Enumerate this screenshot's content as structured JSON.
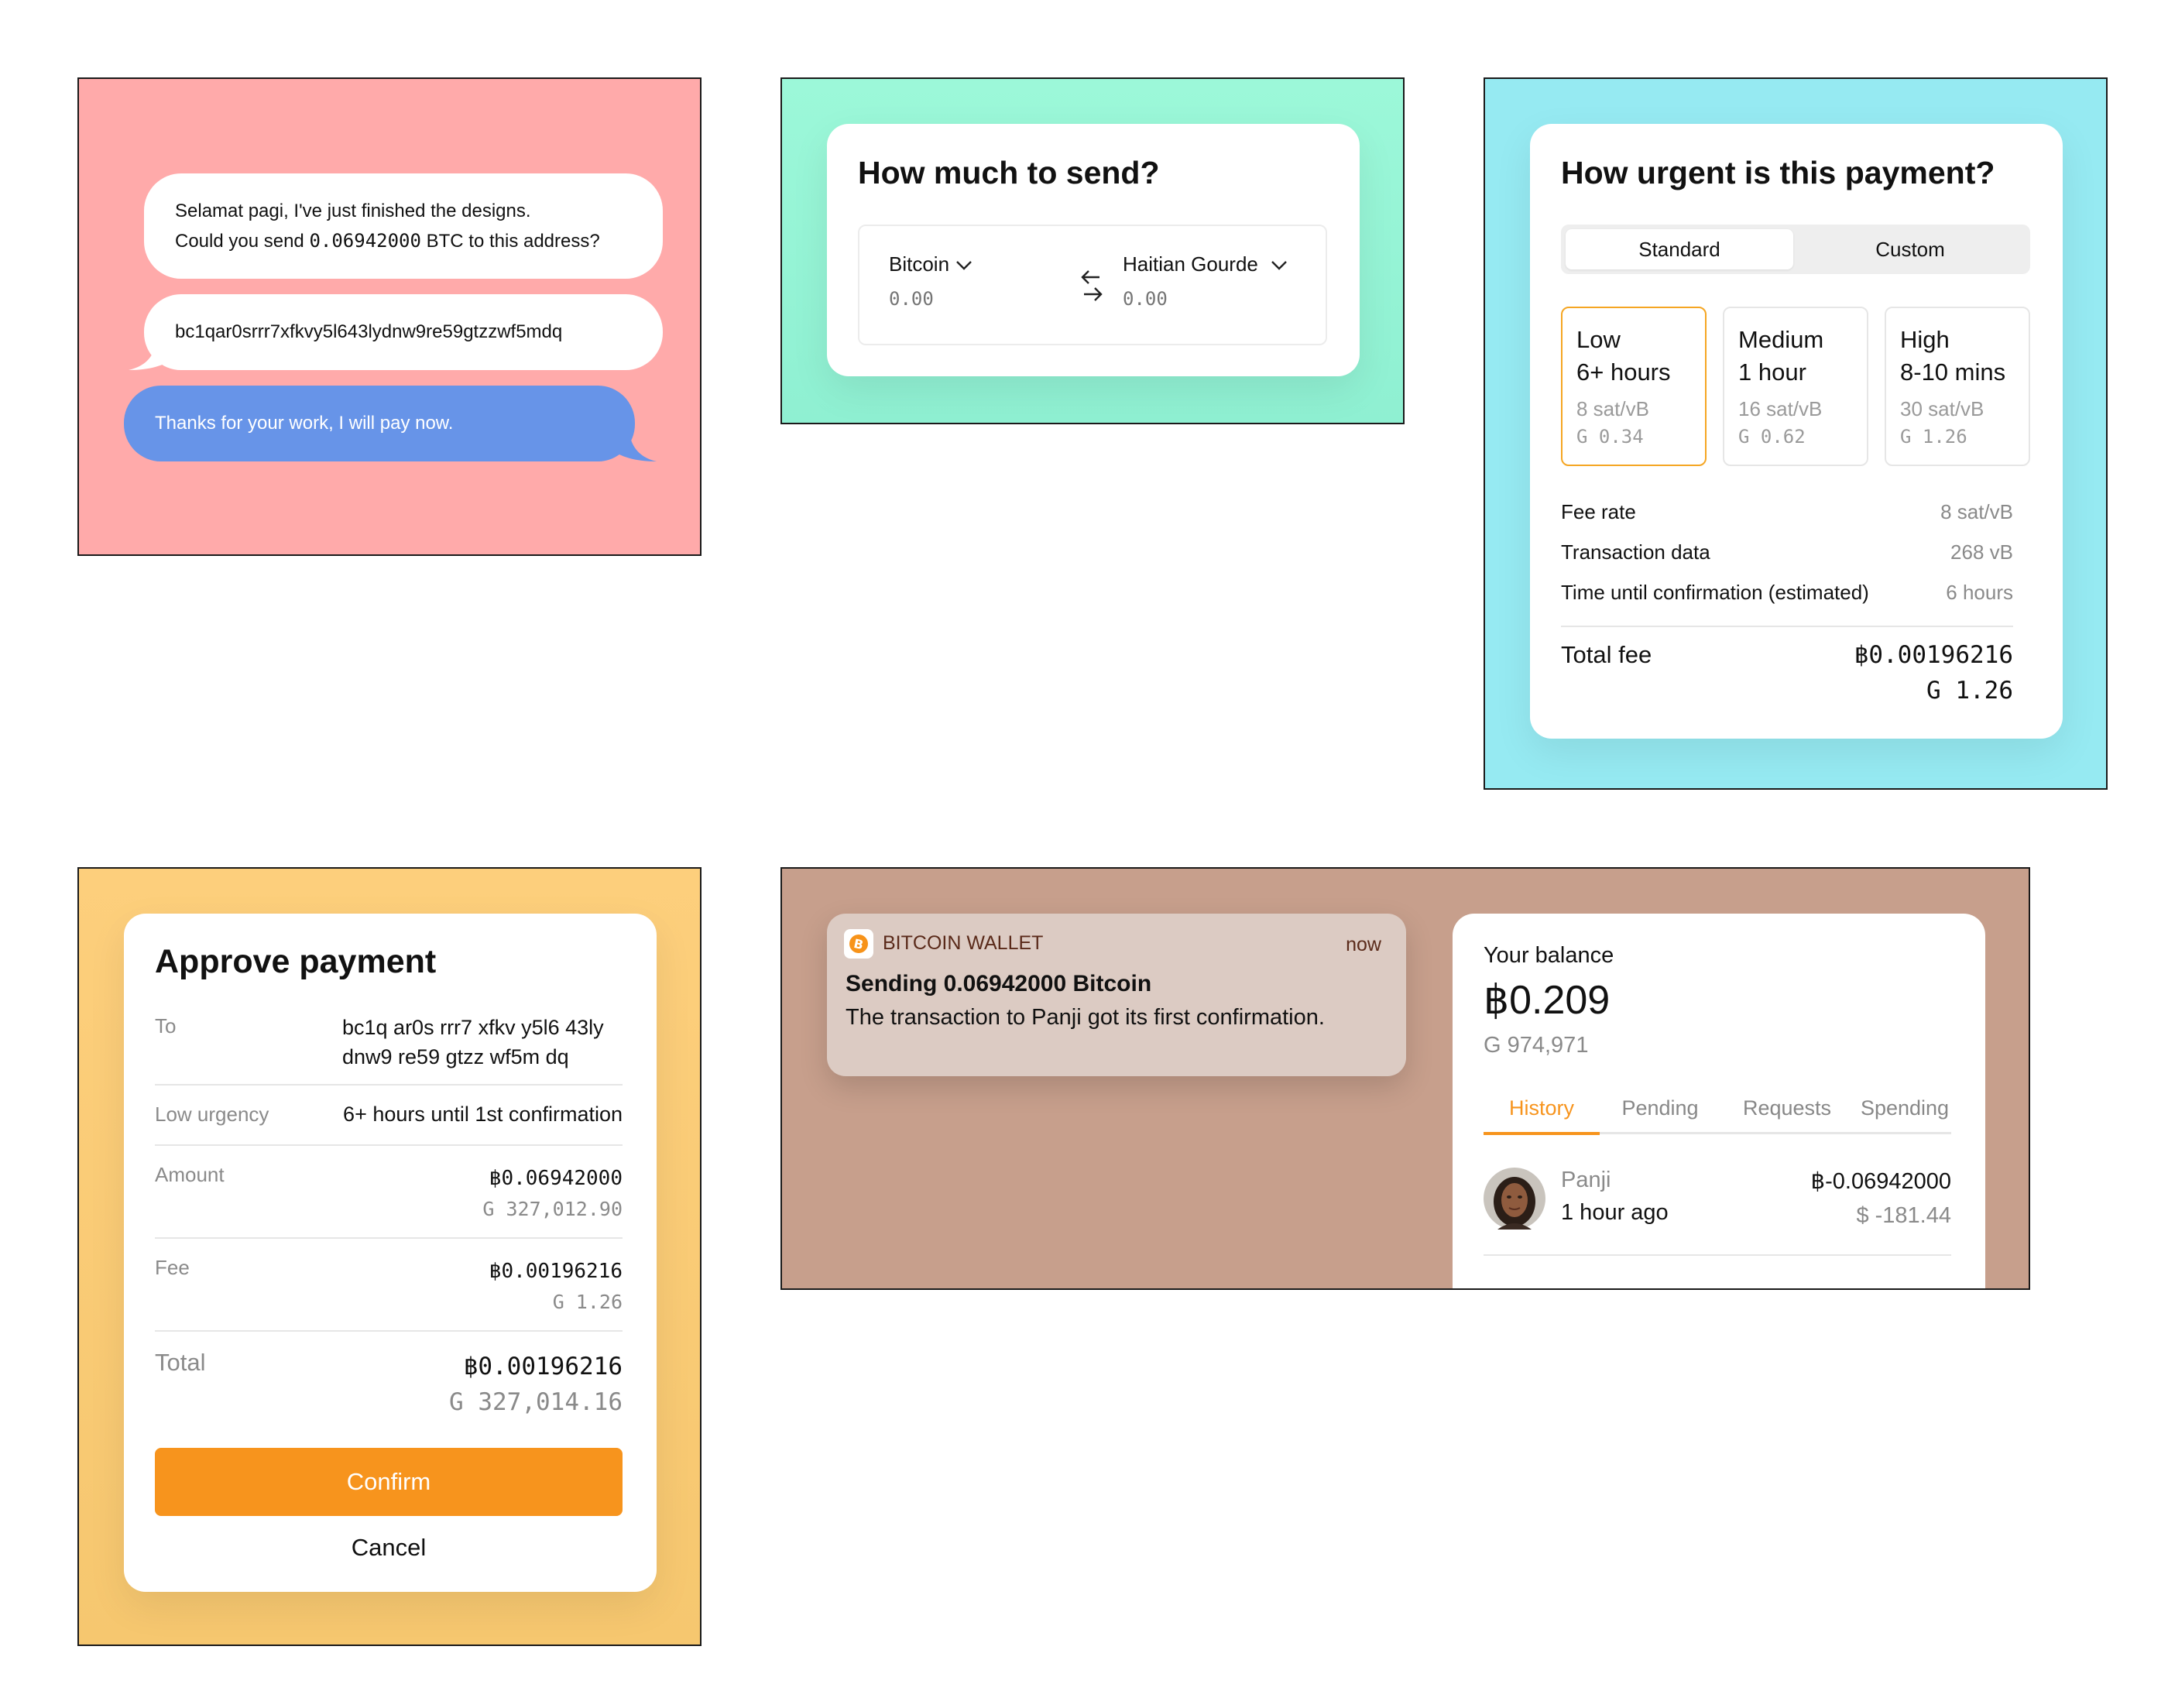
{
  "chat": {
    "message1_line1": "Selamat pagi, I've just finished the designs.",
    "message1_line2_pre": "Could you send ",
    "message1_amount": "0.06942000",
    "message1_line2_post": " BTC to this address?",
    "message2": "bc1qar0srrr7xfkvy5l643lydnw9re59gtzzwf5mdq",
    "message3": "Thanks for your work, I will pay now.",
    "colors": {
      "background": "#ffaaaa",
      "incoming": "#ffffff",
      "outgoing": "#6794e8"
    }
  },
  "send": {
    "title": "How much to send?",
    "from_currency": "Bitcoin",
    "from_placeholder": "0.00",
    "to_currency": "Haitian Gourde",
    "to_placeholder": "0.00",
    "icons": {
      "dropdown": "chevron-down-icon",
      "swap": "swap-arrows-icon"
    }
  },
  "urgency": {
    "title": "How urgent is this payment?",
    "tabs": [
      "Standard",
      "Custom"
    ],
    "selected_tab": "Standard",
    "tiers": [
      {
        "label": "Low",
        "time": "6+ hours",
        "rate": "8 sat/vB",
        "fee": "G 0.34",
        "selected": true
      },
      {
        "label": "Medium",
        "time": "1 hour",
        "rate": "16 sat/vB",
        "fee": "G 0.62",
        "selected": false
      },
      {
        "label": "High",
        "time": "8-10 mins",
        "rate": "30 sat/vB",
        "fee": "G 1.26",
        "selected": false
      }
    ],
    "details": [
      {
        "label": "Fee rate",
        "value": "8 sat/vB"
      },
      {
        "label": "Transaction data",
        "value": "268 vB"
      },
      {
        "label": "Time until confirmation (estimated)",
        "value": "6 hours"
      }
    ],
    "total_label": "Total fee",
    "total_btc": "0.00196216",
    "total_local": "G 1.26",
    "accent": "#f5a623"
  },
  "approve": {
    "title": "Approve payment",
    "to_label": "To",
    "to_line1": "bc1q ar0s rrr7 xfkv y5l6 43ly",
    "to_line2": "dnw9 re59 gtzz wf5m dq",
    "urgency_label": "Low urgency",
    "urgency_value": "6+ hours until 1st confirmation",
    "amount_label": "Amount",
    "amount_btc": "0.06942000",
    "amount_local": "G 327,012.90",
    "fee_label": "Fee",
    "fee_btc": "0.00196216",
    "fee_local": "G 1.26",
    "total_label": "Total",
    "total_btc": "0.00196216",
    "total_local": "G 327,014.16",
    "confirm_label": "Confirm",
    "cancel_label": "Cancel",
    "button_color": "#f7941d"
  },
  "notification": {
    "app_name": "BITCOIN WALLET",
    "time": "now",
    "title": "Sending 0.06942000 Bitcoin",
    "body": "The transaction to Panji got its first confirmation.",
    "icon": "bitcoin-icon"
  },
  "wallet": {
    "balance_label": "Your balance",
    "balance_symbol": "฿",
    "balance_btc": "0.209",
    "balance_local": "G 974,971",
    "tabs": [
      "History",
      "Pending",
      "Requests",
      "Spending"
    ],
    "active_tab": "History",
    "transaction": {
      "name": "Panji",
      "time": "1 hour ago",
      "amount_btc": "-0.06942000",
      "amount_usd": "$ -181.44"
    }
  },
  "btc_symbol": "฿"
}
